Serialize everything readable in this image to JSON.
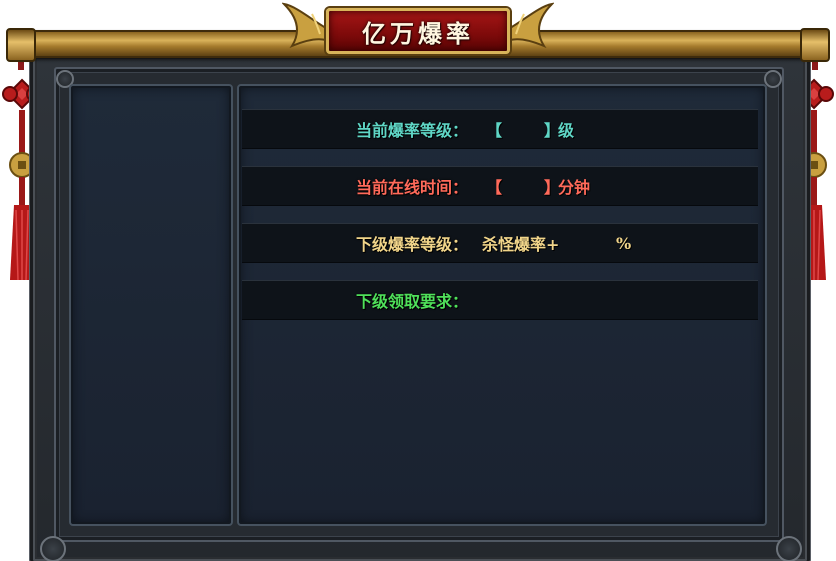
{
  "title": "亿万爆率",
  "colors": {
    "teal": "#5fd6c6",
    "red": "#ff6a5a",
    "gold": "#f1d58a",
    "green": "#4fe05a",
    "panel": "#1c2533"
  },
  "rows": [
    {
      "label": "当前爆率等级：",
      "bracket_open": "【",
      "bracket_close": "】",
      "suffix": "级"
    },
    {
      "label": "当前在线时间：",
      "bracket_open": "【",
      "bracket_close": "】",
      "suffix": "分钟"
    },
    {
      "label": "下级爆率等级：",
      "prefix": "杀怪爆率+",
      "suffix": "%"
    },
    {
      "label": "下级领取要求："
    }
  ]
}
